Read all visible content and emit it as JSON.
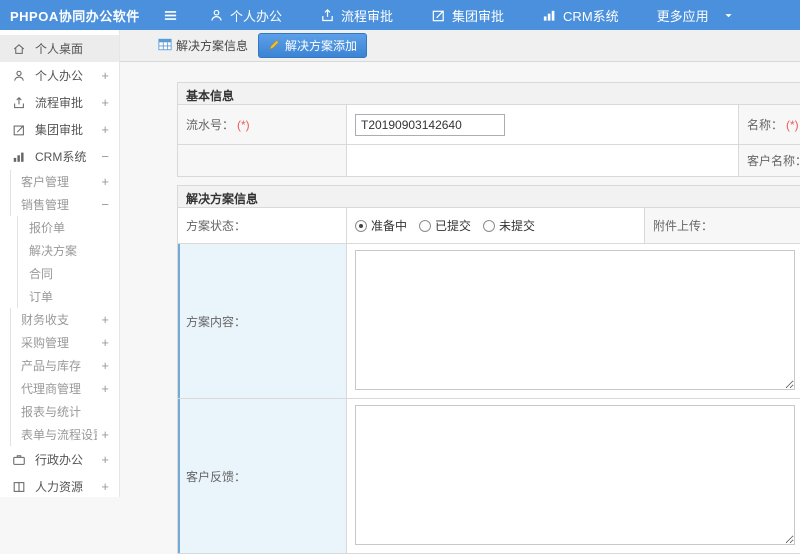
{
  "topbar": {
    "brand": "PHPOA协同办公软件",
    "nav": [
      {
        "label": "个人办公"
      },
      {
        "label": "流程审批"
      },
      {
        "label": "集团审批"
      },
      {
        "label": "CRM系统"
      },
      {
        "label": "更多应用"
      }
    ]
  },
  "sidebar": {
    "items": [
      {
        "label": "个人桌面",
        "expand": "",
        "level": 0,
        "active": true
      },
      {
        "label": "个人办公",
        "expand": "+",
        "level": 0
      },
      {
        "label": "流程审批",
        "expand": "+",
        "level": 0
      },
      {
        "label": "集团审批",
        "expand": "+",
        "level": 0
      },
      {
        "label": "CRM系统",
        "expand": "−",
        "level": 0
      },
      {
        "label": "客户管理",
        "expand": "+",
        "level": 1
      },
      {
        "label": "销售管理",
        "expand": "−",
        "level": 1
      },
      {
        "label": "报价单",
        "expand": "",
        "level": 2
      },
      {
        "label": "解决方案",
        "expand": "",
        "level": 2
      },
      {
        "label": "合同",
        "expand": "",
        "level": 2
      },
      {
        "label": "订单",
        "expand": "",
        "level": 2
      },
      {
        "label": "财务收支",
        "expand": "+",
        "level": 1
      },
      {
        "label": "采购管理",
        "expand": "+",
        "level": 1
      },
      {
        "label": "产品与库存",
        "expand": "+",
        "level": 1
      },
      {
        "label": "代理商管理",
        "expand": "+",
        "level": 1
      },
      {
        "label": "报表与统计",
        "expand": "",
        "level": 1
      },
      {
        "label": "表单与流程设置",
        "expand": "+",
        "level": 1
      },
      {
        "label": "行政办公",
        "expand": "+",
        "level": 0
      },
      {
        "label": "人力资源",
        "expand": "+",
        "level": 0
      }
    ]
  },
  "tabs": {
    "info": "解决方案信息",
    "add": "解决方案添加"
  },
  "form": {
    "basic": {
      "title": "基本信息",
      "serial_label": "流水号：",
      "required": "(*)",
      "serial_value": "T20190903142640",
      "name_label": "名称：",
      "customer_label": "客户名称："
    },
    "solution": {
      "title": "解决方案信息",
      "status_label": "方案状态：",
      "opt1": "准备中",
      "opt2": "已提交",
      "opt3": "未提交",
      "selected_status": "准备中",
      "attachment_label": "附件上传：",
      "content_label": "方案内容：",
      "feedback_label": "客户反馈："
    }
  },
  "colors": {
    "topbar_blue": "#4a90dc",
    "active_tab_blue": "#3c83d4",
    "required_red": "#f05a5a",
    "highlight_cell_blue": "#eaf4fb"
  }
}
